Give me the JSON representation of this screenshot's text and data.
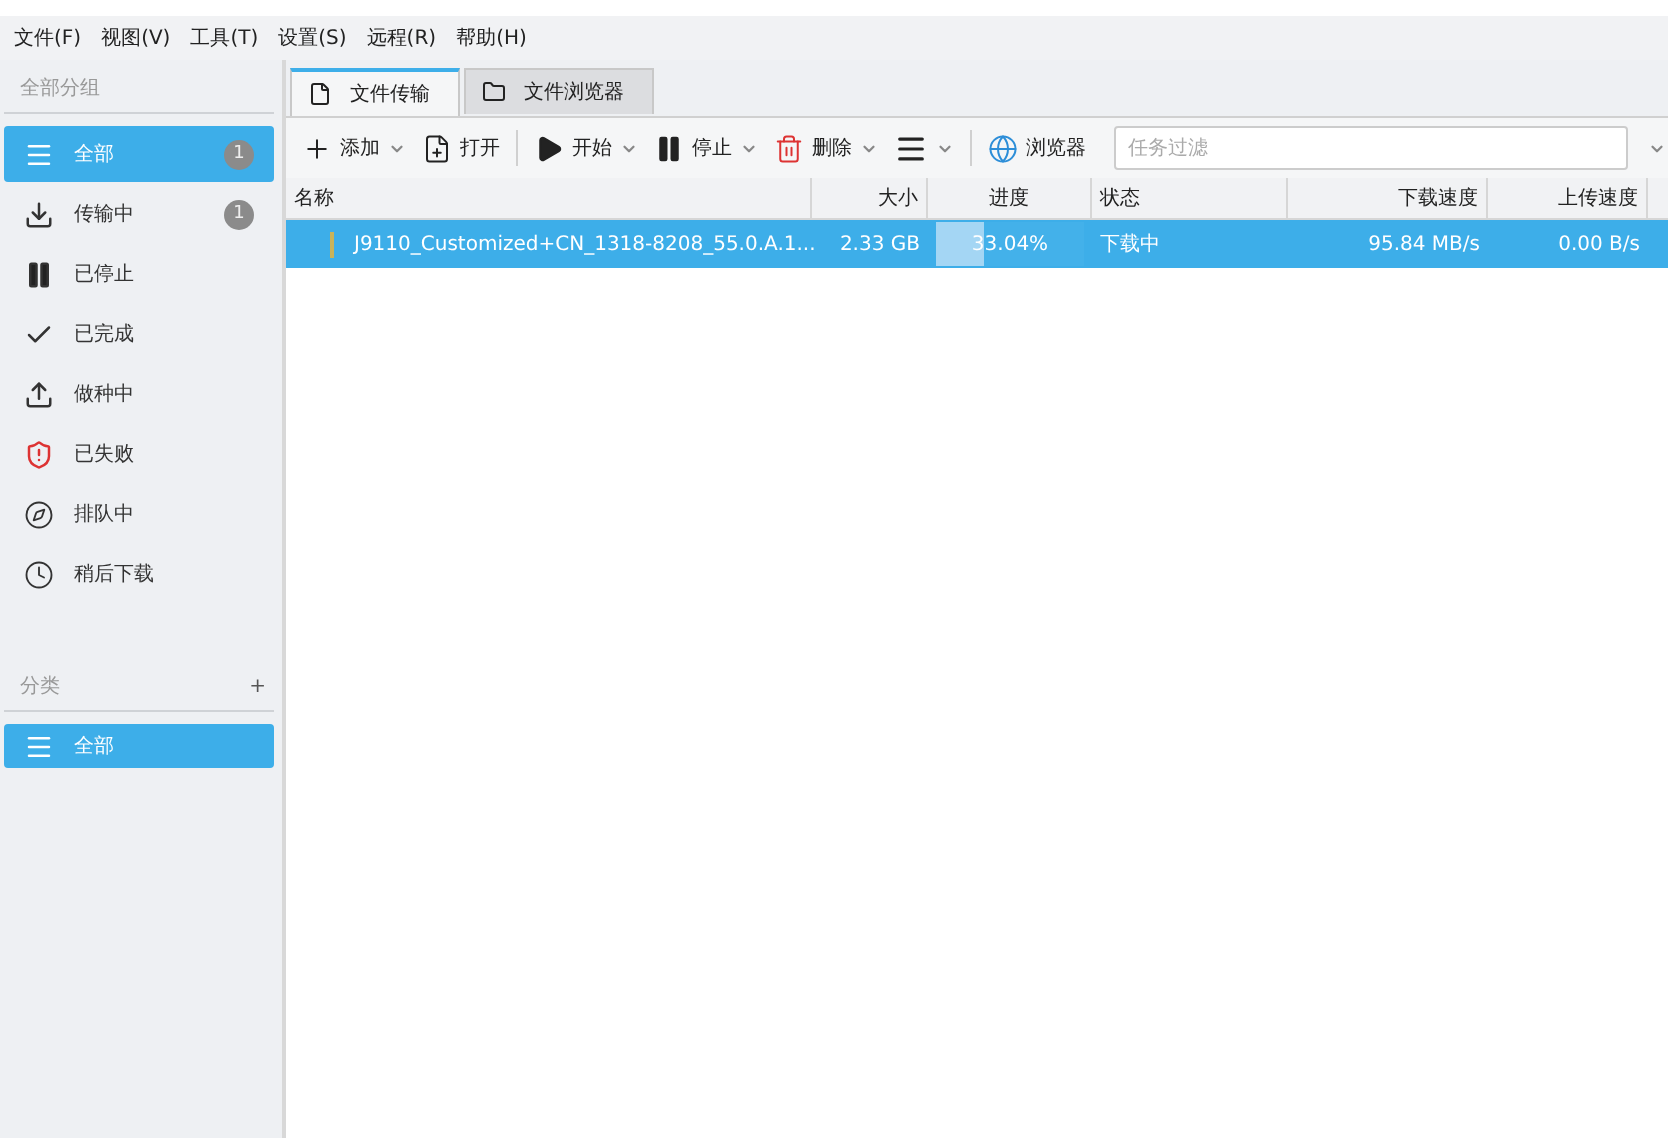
{
  "menu": [
    "文件(F)",
    "视图(V)",
    "工具(T)",
    "设置(S)",
    "远程(R)",
    "帮助(H)"
  ],
  "sidebar": {
    "group_title": "全部分组",
    "items": [
      {
        "kind": "all",
        "label": "全部",
        "count": "1",
        "selected": true
      },
      {
        "kind": "downloading",
        "label": "传输中",
        "count": "1",
        "selected": false
      },
      {
        "kind": "stopped",
        "label": "已停止",
        "selected": false
      },
      {
        "kind": "completed",
        "label": "已完成",
        "selected": false
      },
      {
        "kind": "seeding",
        "label": "做种中",
        "selected": false
      },
      {
        "kind": "failed",
        "label": "已失败",
        "selected": false
      },
      {
        "kind": "queued",
        "label": "排队中",
        "selected": false
      },
      {
        "kind": "later",
        "label": "稍后下载",
        "selected": false
      }
    ],
    "category_title": "分类",
    "category_add": "+",
    "categories": [
      {
        "label": "全部",
        "selected": true
      }
    ]
  },
  "tabs": [
    {
      "kind": "file",
      "label": "文件传输",
      "selected": true
    },
    {
      "kind": "folder",
      "label": "文件浏览器",
      "selected": false
    }
  ],
  "toolbar": [
    {
      "kind": "add",
      "label": "添加",
      "dropdown": true
    },
    {
      "kind": "open",
      "label": "打开",
      "dropdown": false
    },
    {
      "kind": "sep"
    },
    {
      "kind": "start",
      "label": "开始",
      "dropdown": true
    },
    {
      "kind": "stop",
      "label": "停止",
      "dropdown": true
    },
    {
      "kind": "delete",
      "label": "删除",
      "dropdown": true
    },
    {
      "kind": "more",
      "dropdown": true
    },
    {
      "kind": "sep"
    },
    {
      "kind": "browser",
      "label": "浏览器",
      "dropdown": false
    }
  ],
  "filter": {
    "placeholder": "任务过滤"
  },
  "table": {
    "columns": [
      "名称",
      "大小",
      "进度",
      "状态",
      "下载速度",
      "上传速度"
    ],
    "rows": [
      {
        "name": "J9110_Customized+CN_1318-8208_55.0.A.1...",
        "size": "2.33 GB",
        "progress": "33.04%",
        "level": 0.3304,
        "status": "下载中",
        "down": "95.84 MB/s",
        "up": "0.00 B/s",
        "selected": true
      }
    ]
  }
}
